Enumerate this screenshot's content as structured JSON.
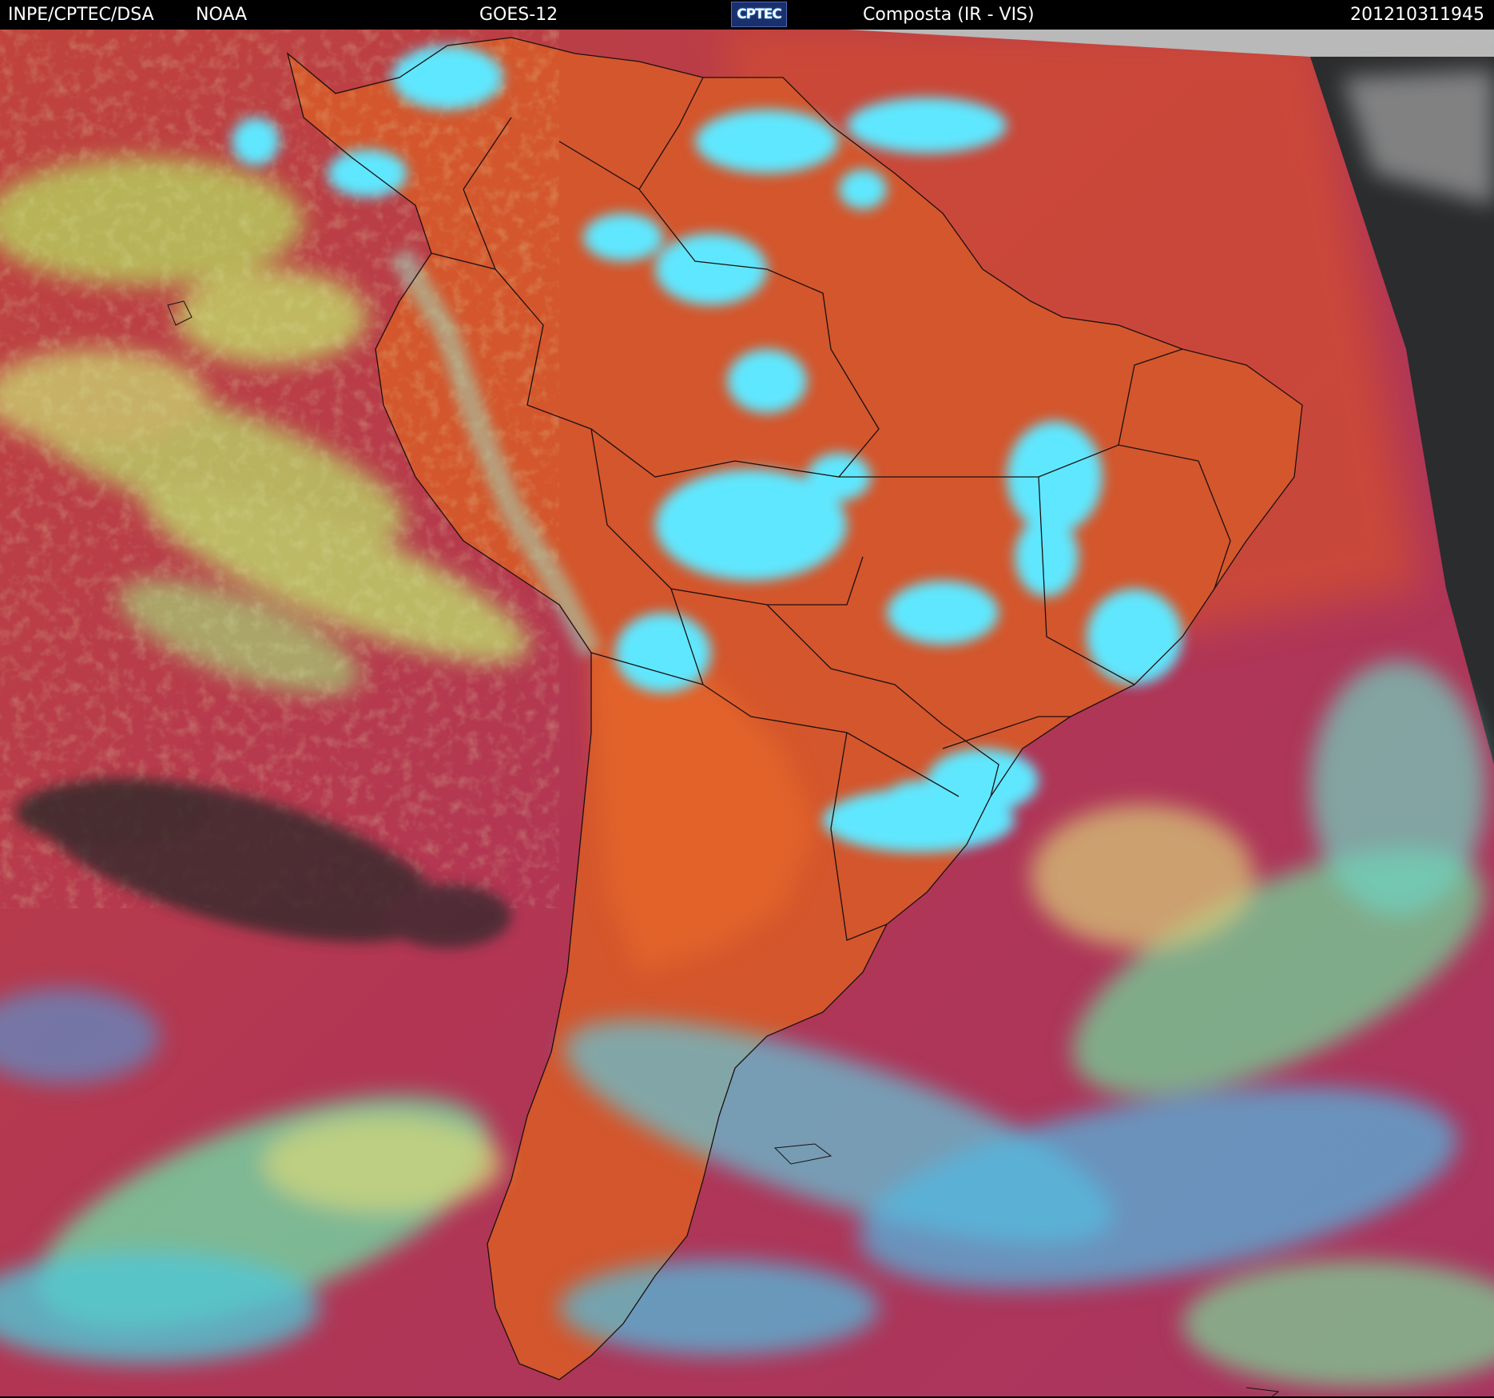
{
  "header": {
    "institution": "INPE/CPTEC/DSA",
    "agency": "NOAA",
    "satellite": "GOES-12",
    "logo_text": "CPTEC",
    "product": "Composta (IR - VIS)",
    "timestamp": "201210311945"
  },
  "colors": {
    "ocean_clear": "#b8344f",
    "land_clear": "#d5542b",
    "low_cloud": "#b9d85a",
    "high_cloud": "#5fe8ff",
    "night_side": "#2a2b2d",
    "borders": "#1a1010"
  }
}
